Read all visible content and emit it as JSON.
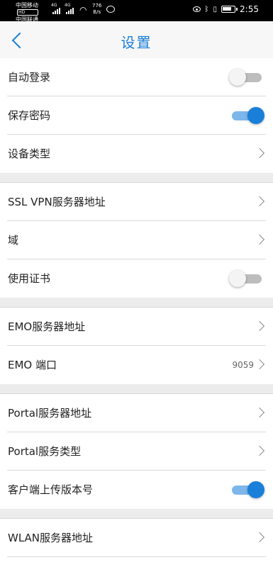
{
  "status_bar": {
    "carrier_1": "中国移动",
    "carrier_2": "中国联通",
    "hd_badge": "HD",
    "lte_1": "4G",
    "lte_2": "4G",
    "net_speed_value": "776",
    "net_speed_unit": "B/s",
    "time": "2:55",
    "icons": [
      "signal-icon",
      "wifi-icon",
      "message-icon",
      "eye-icon",
      "bluetooth-icon",
      "vibrate-icon",
      "battery-icon"
    ]
  },
  "header": {
    "title": "设置",
    "back_icon": "chevron-left-icon"
  },
  "colors": {
    "accent": "#1a7fd8",
    "toggle_on_track": "#7db6ea",
    "toggle_off_track": "#bdbdbd",
    "divider": "#dadada",
    "group_gap": "#ececec"
  },
  "settings": {
    "auto_login": {
      "label": "自动登录",
      "enabled": false
    },
    "save_password": {
      "label": "保存密码",
      "enabled": true
    },
    "device_type": {
      "label": "设备类型"
    },
    "ssl_vpn_server": {
      "label": "SSL VPN服务器地址"
    },
    "domain": {
      "label": "域"
    },
    "use_certificate": {
      "label": "使用证书",
      "enabled": false
    },
    "emo_server": {
      "label": "EMO服务器地址"
    },
    "emo_port": {
      "label": "EMO 端口",
      "value": "9059"
    },
    "portal_server": {
      "label": "Portal服务器地址"
    },
    "portal_service_type": {
      "label": "Portal服务类型"
    },
    "upload_client_version": {
      "label": "客户端上传版本号",
      "enabled": true
    },
    "wlan_server": {
      "label": "WLAN服务器地址"
    }
  }
}
